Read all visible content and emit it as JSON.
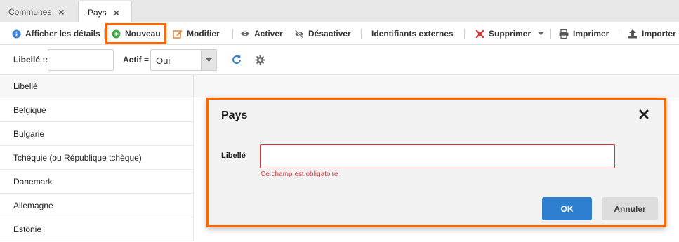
{
  "tabs": [
    {
      "label": "Communes",
      "close": "×"
    },
    {
      "label": "Pays",
      "close": "×"
    }
  ],
  "toolbar": {
    "details": "Afficher les détails",
    "new": "Nouveau",
    "edit": "Modifier",
    "activate": "Activer",
    "deactivate": "Désactiver",
    "external_ids": "Identifiants externes",
    "delete": "Supprimer",
    "print": "Imprimer",
    "import": "Importer"
  },
  "filter": {
    "label_field": "Libellé ::",
    "label_value": "",
    "active_label": "Actif =",
    "active_value": "Oui"
  },
  "grid": {
    "column": "Libellé",
    "rows": [
      "Belgique",
      "Bulgarie",
      "Tchéquie (ou République tchèque)",
      "Danemark",
      "Allemagne",
      "Estonie"
    ]
  },
  "dialog": {
    "title": "Pays",
    "field_label": "Libellé",
    "field_value": "",
    "error": "Ce champ est obligatoire",
    "ok": "OK",
    "cancel": "Annuler"
  },
  "colors": {
    "accent": "#2f7fd0",
    "highlight": "#ff6600",
    "error": "#d8343a",
    "new_icon": "#3aa845",
    "delete_icon": "#d33"
  }
}
